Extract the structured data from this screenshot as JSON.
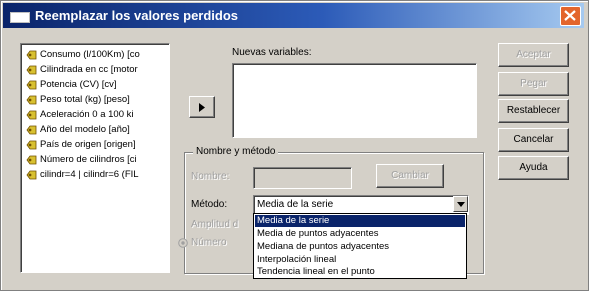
{
  "window": {
    "title": "Reemplazar los valores perdidos"
  },
  "variables": [
    "Consumo (l/100Km) [co",
    "Cilindrada en cc [motor",
    "Potencia (CV) [cv]",
    "Peso total (kg) [peso]",
    "Aceleración 0 a 100 ki",
    "Año del modelo [año]",
    "País de origen [origen]",
    "Número de cilindros [ci",
    "cilindr=4 | cilindr=6 (FIL"
  ],
  "labels": {
    "new_vars": "Nuevas variables:",
    "group": "Nombre y método",
    "name": "Nombre:",
    "method": "Método:",
    "span_partial": "Amplitud d",
    "radio_partial": "Número"
  },
  "buttons": {
    "accept": "Aceptar",
    "paste": "Pegar",
    "reset": "Restablecer",
    "cancel": "Cancelar",
    "help": "Ayuda",
    "change": "Cambiar"
  },
  "method": {
    "selected": "Media de la serie",
    "options": [
      "Media de la serie",
      "Media de puntos adyacentes",
      "Mediana de puntos adyacentes",
      "Interpolación lineal",
      "Tendencia lineal en el punto"
    ],
    "highlighted_index": 0
  },
  "colors": {
    "title_gradient_start": "#0a246a",
    "title_gradient_end": "#a6caf0",
    "close_button": "#e3652c",
    "selection": "#0a246a",
    "dialog_face": "#d4d0c8"
  },
  "icons": {
    "variable": "scale-variable-icon",
    "move": "right-arrow-icon",
    "close": "close-x-icon",
    "dropdown": "chevron-down-icon"
  }
}
